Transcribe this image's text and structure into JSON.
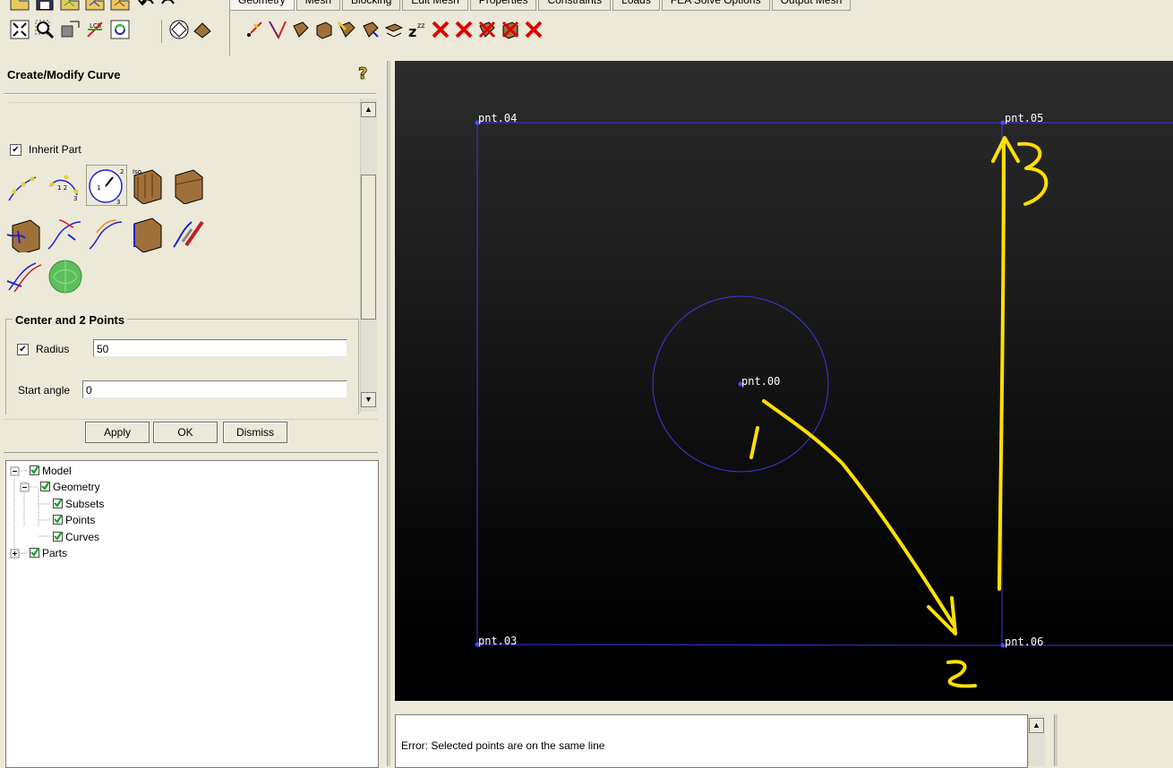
{
  "toolbar": {
    "tabs": [
      {
        "label": "Geometry"
      },
      {
        "label": "Mesh"
      },
      {
        "label": "Blocking"
      },
      {
        "label": "Edit Mesh"
      },
      {
        "label": "Properties"
      },
      {
        "label": "Constraints"
      },
      {
        "label": "Loads"
      },
      {
        "label": "FEA Solve Options"
      },
      {
        "label": "Output Mesh"
      }
    ]
  },
  "panel": {
    "title": "Create/Modify Curve",
    "inherit_part_label": "Inherit Part",
    "inherit_part_checked": true,
    "group_title": "Center and 2 Points",
    "radius_label": "Radius",
    "radius_checked": true,
    "radius_value": "50",
    "start_angle_label": "Start angle",
    "start_angle_value": "0",
    "apply_label": "Apply",
    "ok_label": "OK",
    "dismiss_label": "Dismiss"
  },
  "tree": {
    "model": "Model",
    "geometry": "Geometry",
    "subsets": "Subsets",
    "points": "Points",
    "curves": "Curves",
    "parts": "Parts"
  },
  "viewport": {
    "points": [
      {
        "label": "pnt.04"
      },
      {
        "label": "pnt.05"
      },
      {
        "label": "pnt.00"
      },
      {
        "label": "pnt.03"
      },
      {
        "label": "pnt.06"
      }
    ],
    "annotations": [
      "1",
      "2",
      "3"
    ]
  },
  "message": {
    "text": "Error: Selected points are on the same line"
  },
  "colors": {
    "curve": "#3a3ae0",
    "annotation": "#ffe000",
    "point": "#4a4aff"
  }
}
